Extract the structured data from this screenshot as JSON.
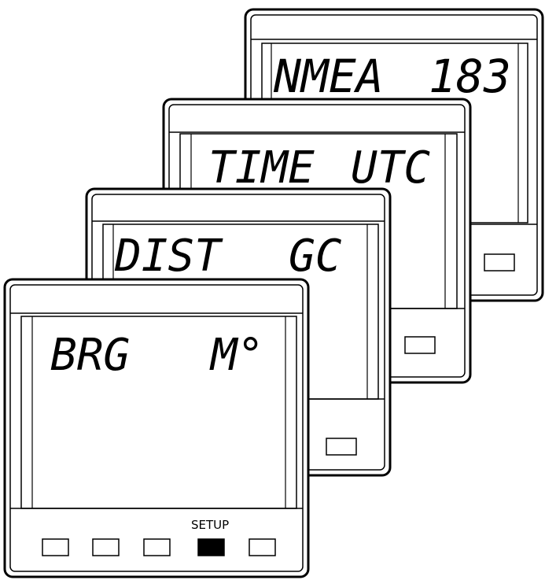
{
  "panels": [
    {
      "id": "panel-4",
      "display_left": "NMEA",
      "display_right": "183"
    },
    {
      "id": "panel-3",
      "display_left": "TIME",
      "display_right": "UTC"
    },
    {
      "id": "panel-2",
      "display_left": "DIST",
      "display_right": "GC"
    },
    {
      "id": "panel-1",
      "display_left": "BRG",
      "display_right": "M°"
    }
  ],
  "front_buttons": {
    "setup_label": "SETUP",
    "count": 5,
    "active_index": 3
  },
  "colors": {
    "line": "#000000",
    "background": "#ffffff",
    "active_button": "#000000"
  }
}
